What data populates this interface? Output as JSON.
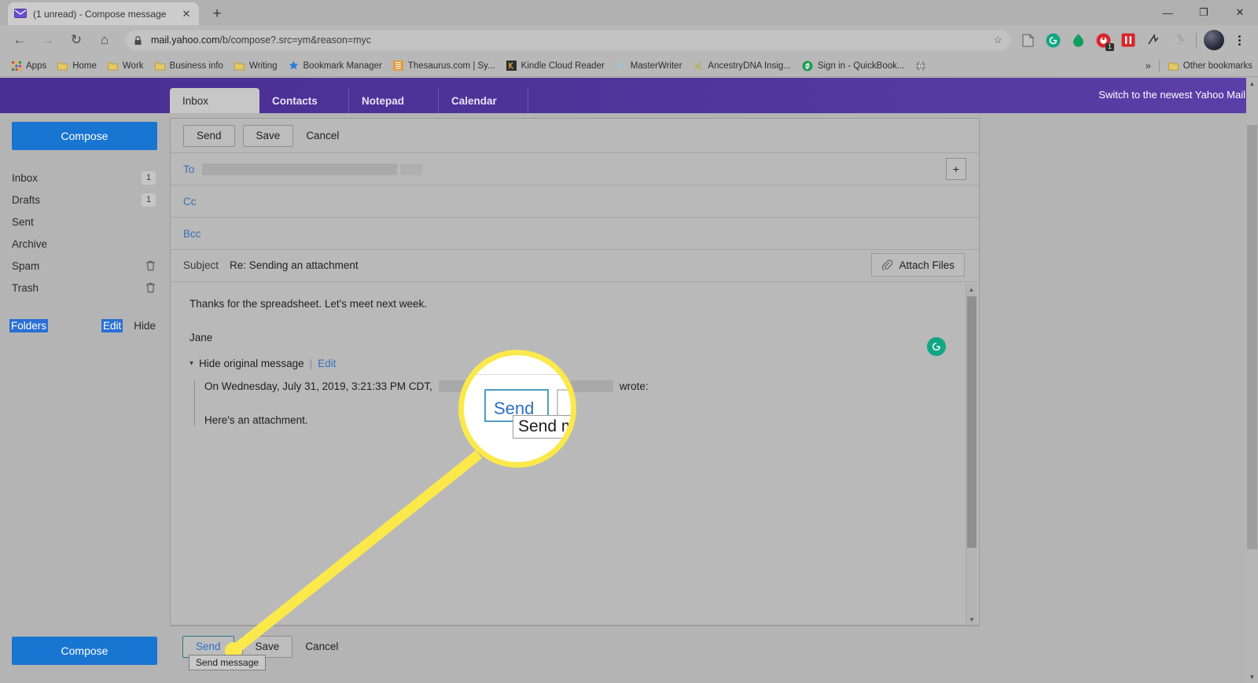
{
  "browser": {
    "tab": {
      "title": "(1 unread) - Compose message",
      "favicon": "mail-envelope-icon",
      "close_label": "✕"
    },
    "new_tab_label": "+",
    "window_controls": {
      "minimize": "—",
      "maximize": "❐",
      "close": "✕"
    },
    "nav": {
      "back": "←",
      "forward": "→",
      "reload": "↻",
      "home": "⌂"
    },
    "omnibox": {
      "url_host": "mail.yahoo.com",
      "url_path": "/b/compose?.src=ym&reason=myc",
      "lock_icon": "padlock-icon",
      "star_icon": "☆"
    },
    "extensions": [
      {
        "name": "reading-mode-icon"
      },
      {
        "name": "grammarly-extension-icon"
      },
      {
        "name": "green-drop-icon"
      },
      {
        "name": "adblock-icon",
        "badge": "1"
      },
      {
        "name": "pocket-icon"
      },
      {
        "name": "evernote-icon"
      },
      {
        "name": "google-drive-icon"
      }
    ],
    "bookmarks": [
      {
        "label": "Apps",
        "icon": "apps-grid-icon"
      },
      {
        "label": "Home",
        "icon": "folder-icon"
      },
      {
        "label": "Work",
        "icon": "folder-icon"
      },
      {
        "label": "Business info",
        "icon": "folder-icon"
      },
      {
        "label": "Writing",
        "icon": "folder-icon"
      },
      {
        "label": "Bookmark Manager",
        "icon": "star-icon"
      },
      {
        "label": "Thesaurus.com | Sy...",
        "icon": "thesaurus-icon"
      },
      {
        "label": "Kindle Cloud Reader",
        "icon": "kindle-icon"
      },
      {
        "label": "MasterWriter",
        "icon": "masterwriter-icon"
      },
      {
        "label": "AncestryDNA Insig...",
        "icon": "ancestry-icon"
      },
      {
        "label": "Sign in - QuickBook...",
        "icon": "quickbooks-icon"
      },
      {
        "label": "",
        "icon": "globe-icon"
      }
    ],
    "bookmarks_overflow": "»",
    "other_bookmarks": {
      "label": "Other bookmarks",
      "icon": "folder-icon"
    }
  },
  "mail": {
    "tabs": [
      {
        "label": "Inbox",
        "active": true
      },
      {
        "label": "Contacts",
        "active": false
      },
      {
        "label": "Notepad",
        "active": false
      },
      {
        "label": "Calendar",
        "active": false
      }
    ],
    "switch_link": "Switch to the newest Yahoo Mail",
    "sidebar": {
      "compose_label": "Compose",
      "folders": [
        {
          "label": "Inbox",
          "badge": "1",
          "trash": false
        },
        {
          "label": "Drafts",
          "badge": "1",
          "trash": false
        },
        {
          "label": "Sent",
          "badge": "",
          "trash": false
        },
        {
          "label": "Archive",
          "badge": "",
          "trash": false
        },
        {
          "label": "Spam",
          "badge": "",
          "trash": true
        },
        {
          "label": "Trash",
          "badge": "",
          "trash": true
        }
      ],
      "folders_section": {
        "title": "Folders",
        "edit": "Edit",
        "hide": "Hide"
      }
    },
    "compose": {
      "toolbar": {
        "send": "Send",
        "save": "Save",
        "cancel": "Cancel"
      },
      "to_label": "To",
      "to_value": "",
      "cc_label": "Cc",
      "cc_value": "",
      "bcc_label": "Bcc",
      "bcc_value": "",
      "add_recipient_label": "+",
      "subject_label": "Subject",
      "subject_value": "Re: Sending an attachment",
      "attach_label": "Attach Files",
      "body_line_1": "Thanks for the spreadsheet. Let's meet next week.",
      "body_line_2": "Jane",
      "hide_original": "Hide original message",
      "edit_link": "Edit",
      "quote_prefix": "On Wednesday, July 31, 2019, 3:21:33 PM CDT,",
      "quote_suffix": "wrote:",
      "quote_body": "Here's an attachment.",
      "grammarly_icon": "grammarly-icon"
    },
    "bottom_toolbar": {
      "send": "Send",
      "save": "Save",
      "cancel": "Cancel"
    },
    "tooltip": "Send message"
  },
  "callout": {
    "magnified_button": "Send",
    "magnified_tooltip": "Send me",
    "highlight_color": "#fbe94b"
  }
}
